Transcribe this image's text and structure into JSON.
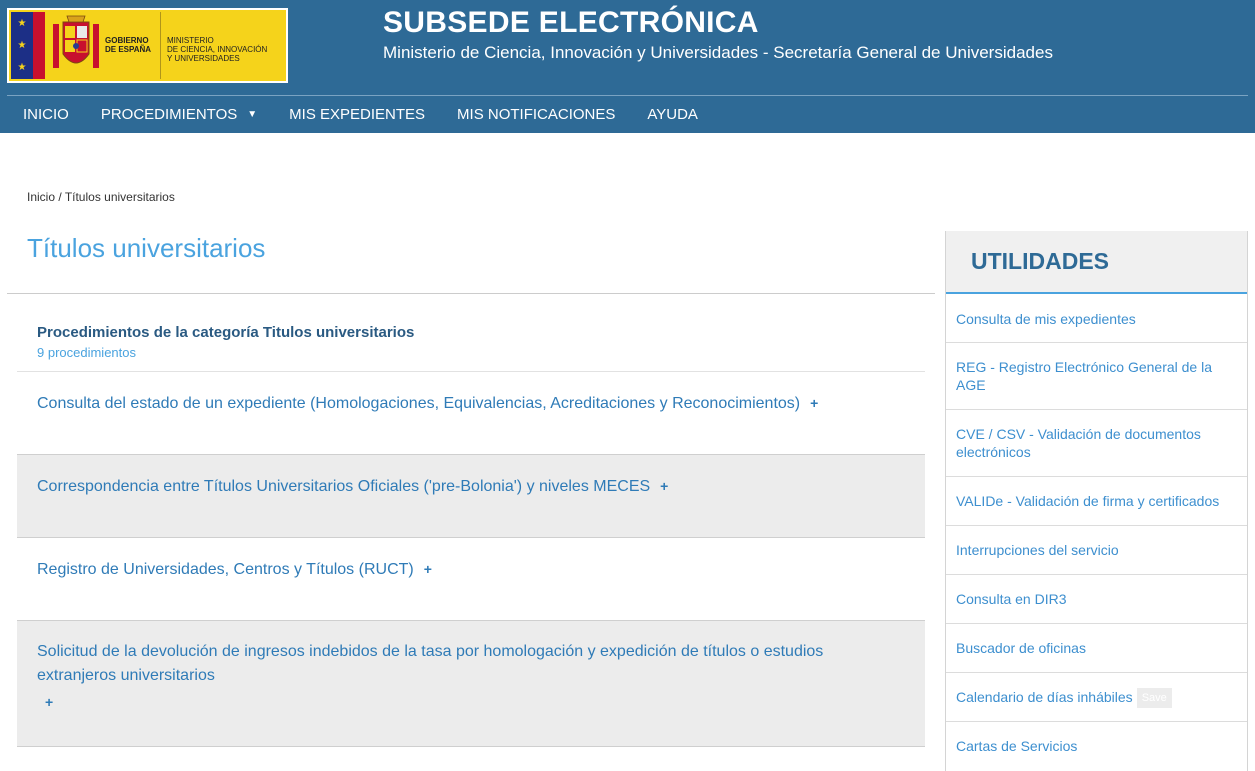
{
  "header": {
    "gobierno_line1": "GOBIERNO",
    "gobierno_line2": "DE ESPAÑA",
    "ministerio_line1": "MINISTERIO",
    "ministerio_line2": "DE CIENCIA, INNOVACIÓN",
    "ministerio_line3": "Y UNIVERSIDADES",
    "title": "SUBSEDE ELECTRÓNICA",
    "subtitle": "Ministerio de Ciencia, Innovación y Universidades - Secretaría General de Universidades"
  },
  "nav": {
    "items": [
      "INICIO",
      "PROCEDIMIENTOS",
      "MIS EXPEDIENTES",
      "MIS NOTIFICACIONES",
      "AYUDA"
    ],
    "caret": "▼"
  },
  "breadcrumb": {
    "home": "Inicio",
    "separator": " / ",
    "current": "Títulos universitarios"
  },
  "page": {
    "title": "Títulos universitarios"
  },
  "procedures": {
    "heading": "Procedimientos de la categoría Titulos universitarios",
    "count": "9 procedimientos",
    "plus": "+",
    "items": [
      "Consulta del estado de un expediente (Homologaciones, Equivalencias, Acreditaciones y Reconocimientos)",
      "Correspondencia entre Títulos Universitarios Oficiales ('pre-Bolonia') y niveles MECES",
      "Registro de Universidades, Centros y Títulos (RUCT)",
      "Solicitud de la devolución de ingresos indebidos de la tasa por homologación y expedición de títulos o estudios extranjeros universitarios"
    ]
  },
  "sidebar": {
    "title": "UTILIDADES",
    "save_label": "Save",
    "items": [
      "Consulta de mis expedientes",
      "REG - Registro Electrónico General de la AGE",
      "CVE / CSV - Validación de documentos electrónicos",
      "VALIDe - Validación de firma y certificados",
      "Interrupciones del servicio",
      "Consulta en DIR3",
      "Buscador de oficinas",
      "Calendario de días inhábiles",
      "Cartas de Servicios"
    ]
  }
}
